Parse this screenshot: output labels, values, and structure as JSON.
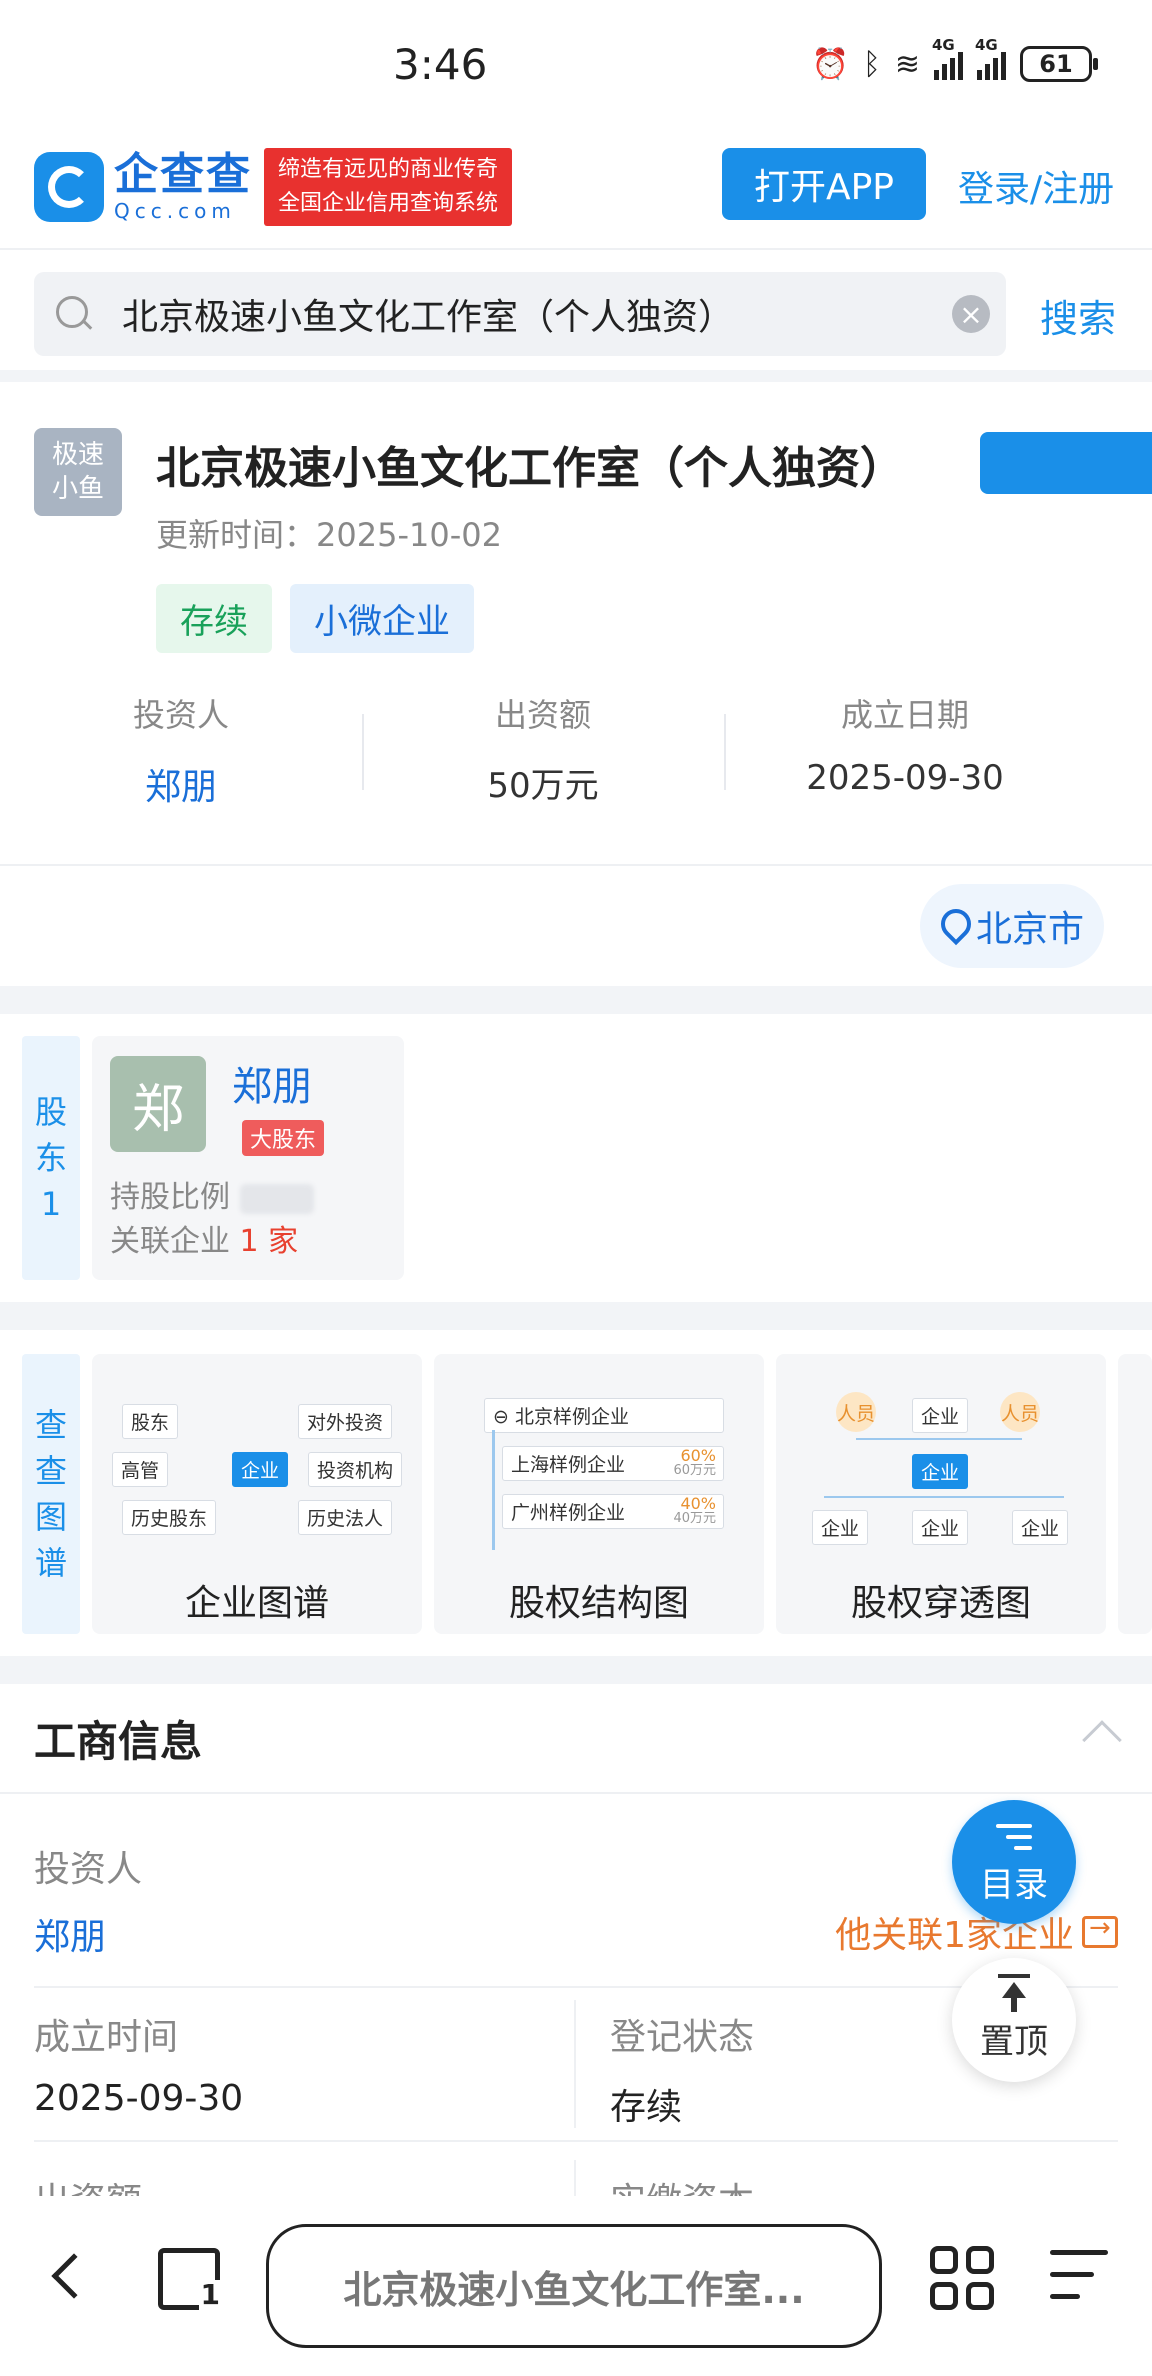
{
  "status_bar": {
    "time": "3:46",
    "network": "4G",
    "network2": "4G",
    "battery": "61"
  },
  "header": {
    "logo_name": "企查查",
    "logo_domain": "Qcc.com",
    "slogan_line1": "缔造有远见的商业传奇",
    "slogan_line2": "全国企业信用查询系统",
    "open_app": "打开APP",
    "login": "登录/注册"
  },
  "search": {
    "value": "北京极速小鱼文化工作室（个人独资）",
    "button": "搜索"
  },
  "company": {
    "logo_line1": "极速",
    "logo_line2": "小鱼",
    "name": "北京极速小鱼文化工作室（个人独资）",
    "update_label": "更新时间：",
    "update_time": "2025-10-02",
    "tags": [
      "存续",
      "小微企业"
    ],
    "stats": [
      {
        "label": "投资人",
        "value": "郑朋"
      },
      {
        "label": "出资额",
        "value": "50万元"
      },
      {
        "label": "成立日期",
        "value": "2025-09-30"
      }
    ],
    "location": "北京市"
  },
  "shareholders": {
    "side_label": [
      "股",
      "东",
      "1"
    ],
    "holder": {
      "avatar_char": "郑",
      "name": "郑朋",
      "badge": "大股东",
      "ratio_label": "持股比例",
      "related_label": "关联企业",
      "related_count": "1 家"
    }
  },
  "graphs": {
    "side_label": [
      "查",
      "查",
      "图",
      "谱"
    ],
    "cards": [
      {
        "title": "企业图谱",
        "nodes": [
          "股东",
          "对外投资",
          "高管",
          "企业",
          "投资机构",
          "历史股东",
          "历史法人"
        ]
      },
      {
        "title": "股权结构图",
        "root": "北京样例企业",
        "children": [
          {
            "name": "上海样例企业",
            "pct": "60%",
            "amount": "60万元"
          },
          {
            "name": "广州样例企业",
            "pct": "40%",
            "amount": "40万元"
          }
        ]
      },
      {
        "title": "股权穿透图",
        "nodes": [
          "人员",
          "企业",
          "人员",
          "企业",
          "企业",
          "企业",
          "企业"
        ]
      }
    ]
  },
  "business_info": {
    "title": "工商信息",
    "investor_label": "投资人",
    "investor_value": "郑朋",
    "related": "他关联1家企业",
    "established_label": "成立时间",
    "established_value": "2025-09-30",
    "status_label": "登记状态",
    "status_value": "存续",
    "capital_label": "出资额",
    "paid_label": "实缴资本"
  },
  "fab": {
    "menu": "目录",
    "top": "置顶"
  },
  "browser": {
    "url_text": "北京极速小鱼文化工作室...",
    "tabs_count": "1"
  }
}
